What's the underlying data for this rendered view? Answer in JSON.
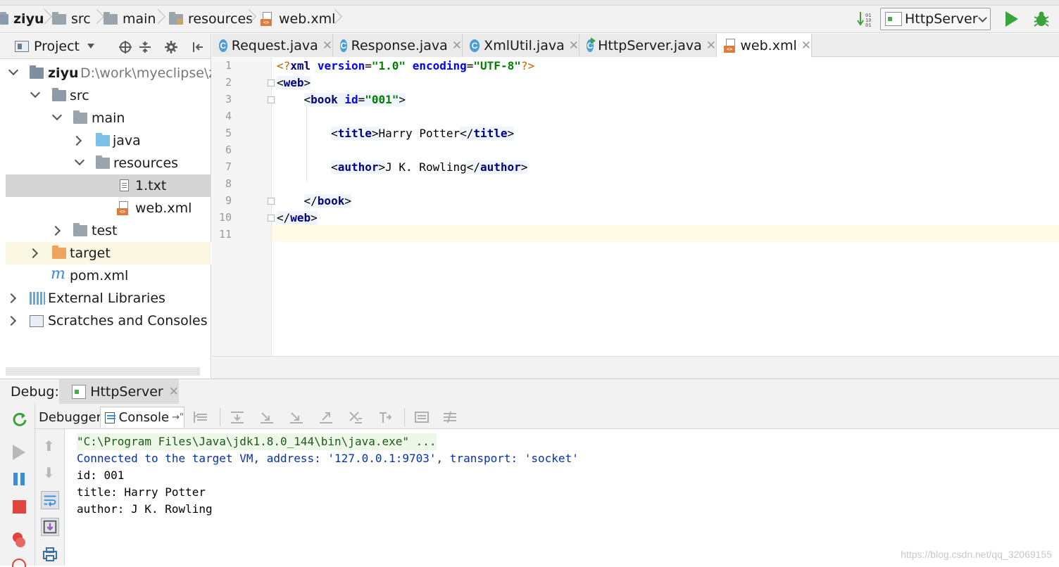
{
  "breadcrumb": [
    "ziyu",
    "src",
    "main",
    "resources",
    "web.xml"
  ],
  "run_config": "HttpServer",
  "project_panel": {
    "title": "Project",
    "tree": [
      {
        "label": "ziyu",
        "path": "D:\\work\\myeclipse\\ziy"
      },
      {
        "label": "src"
      },
      {
        "label": "main"
      },
      {
        "label": "java"
      },
      {
        "label": "resources"
      },
      {
        "label": "1.txt"
      },
      {
        "label": "web.xml"
      },
      {
        "label": "test"
      },
      {
        "label": "target"
      },
      {
        "label": "pom.xml"
      },
      {
        "label": "External Libraries"
      },
      {
        "label": "Scratches and Consoles"
      }
    ]
  },
  "editor_tabs": [
    {
      "label": "Request.java"
    },
    {
      "label": "Response.java"
    },
    {
      "label": "XmlUtil.java"
    },
    {
      "label": "HttpServer.java"
    },
    {
      "label": "web.xml"
    }
  ],
  "code": {
    "line_numbers": [
      "1",
      "2",
      "3",
      "4",
      "5",
      "6",
      "7",
      "8",
      "9",
      "10",
      "11"
    ],
    "decl": {
      "open": "<?",
      "name": "xml",
      "attr1": "version",
      "val1": "\"1.0\"",
      "attr2": "encoding",
      "val2": "\"UTF-8\"",
      "close": "?>"
    },
    "web_open": "web",
    "book_open": "book",
    "book_attr": "id",
    "book_val": "\"001\"",
    "title_tag": "title",
    "title_text": "Harry Potter",
    "author_tag": "author",
    "author_text": "J K. Rowling",
    "book_close": "book",
    "web_close": "web"
  },
  "debug": {
    "label": "Debug:",
    "session_tab": "HttpServer",
    "tabs": {
      "debugger": "Debugger",
      "console": "Console"
    },
    "console_lines": [
      "\"C:\\Program Files\\Java\\jdk1.8.0_144\\bin\\java.exe\" ...",
      "Connected to the target VM, address: '127.0.0.1:9703', transport: 'socket'",
      "id: 001",
      "title: Harry Potter",
      "author: J K. Rowling"
    ]
  },
  "watermark": "https://blog.csdn.net/qq_32069155",
  "colors": {
    "run_green": "#3aa33a",
    "stop_red": "#e0443e",
    "tag_blue": "#000080",
    "attr_blue": "#0000ff",
    "string_green": "#008000",
    "current_line": "#fdfae6"
  }
}
